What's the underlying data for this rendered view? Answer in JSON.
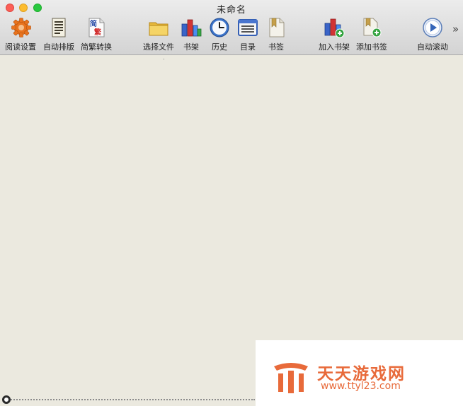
{
  "window": {
    "title": "未命名"
  },
  "toolbar": {
    "items": [
      {
        "label": "阅读设置",
        "icon": "gear-icon"
      },
      {
        "label": "自动排版",
        "icon": "document-lines-icon"
      },
      {
        "label": "简繁转换",
        "icon": "chinese-convert-icon",
        "icon_text_top": "简",
        "icon_text_bottom": "繁"
      },
      {
        "label": "选择文件",
        "icon": "folder-icon"
      },
      {
        "label": "书架",
        "icon": "bookshelf-icon"
      },
      {
        "label": "历史",
        "icon": "clock-icon"
      },
      {
        "label": "目录",
        "icon": "list-icon"
      },
      {
        "label": "书签",
        "icon": "bookmark-icon"
      },
      {
        "label": "加入书架",
        "icon": "add-bookshelf-icon"
      },
      {
        "label": "添加书签",
        "icon": "add-bookmark-icon"
      },
      {
        "label": "自动滚动",
        "icon": "play-circle-icon"
      }
    ],
    "overflow_glyph": "»"
  },
  "reading_progress": 0,
  "watermark": {
    "text": "天天游戏网",
    "url": "www.ttyl23.com"
  },
  "colors": {
    "content_bg": "#ebe9df",
    "watermark": "#e86a3a"
  }
}
